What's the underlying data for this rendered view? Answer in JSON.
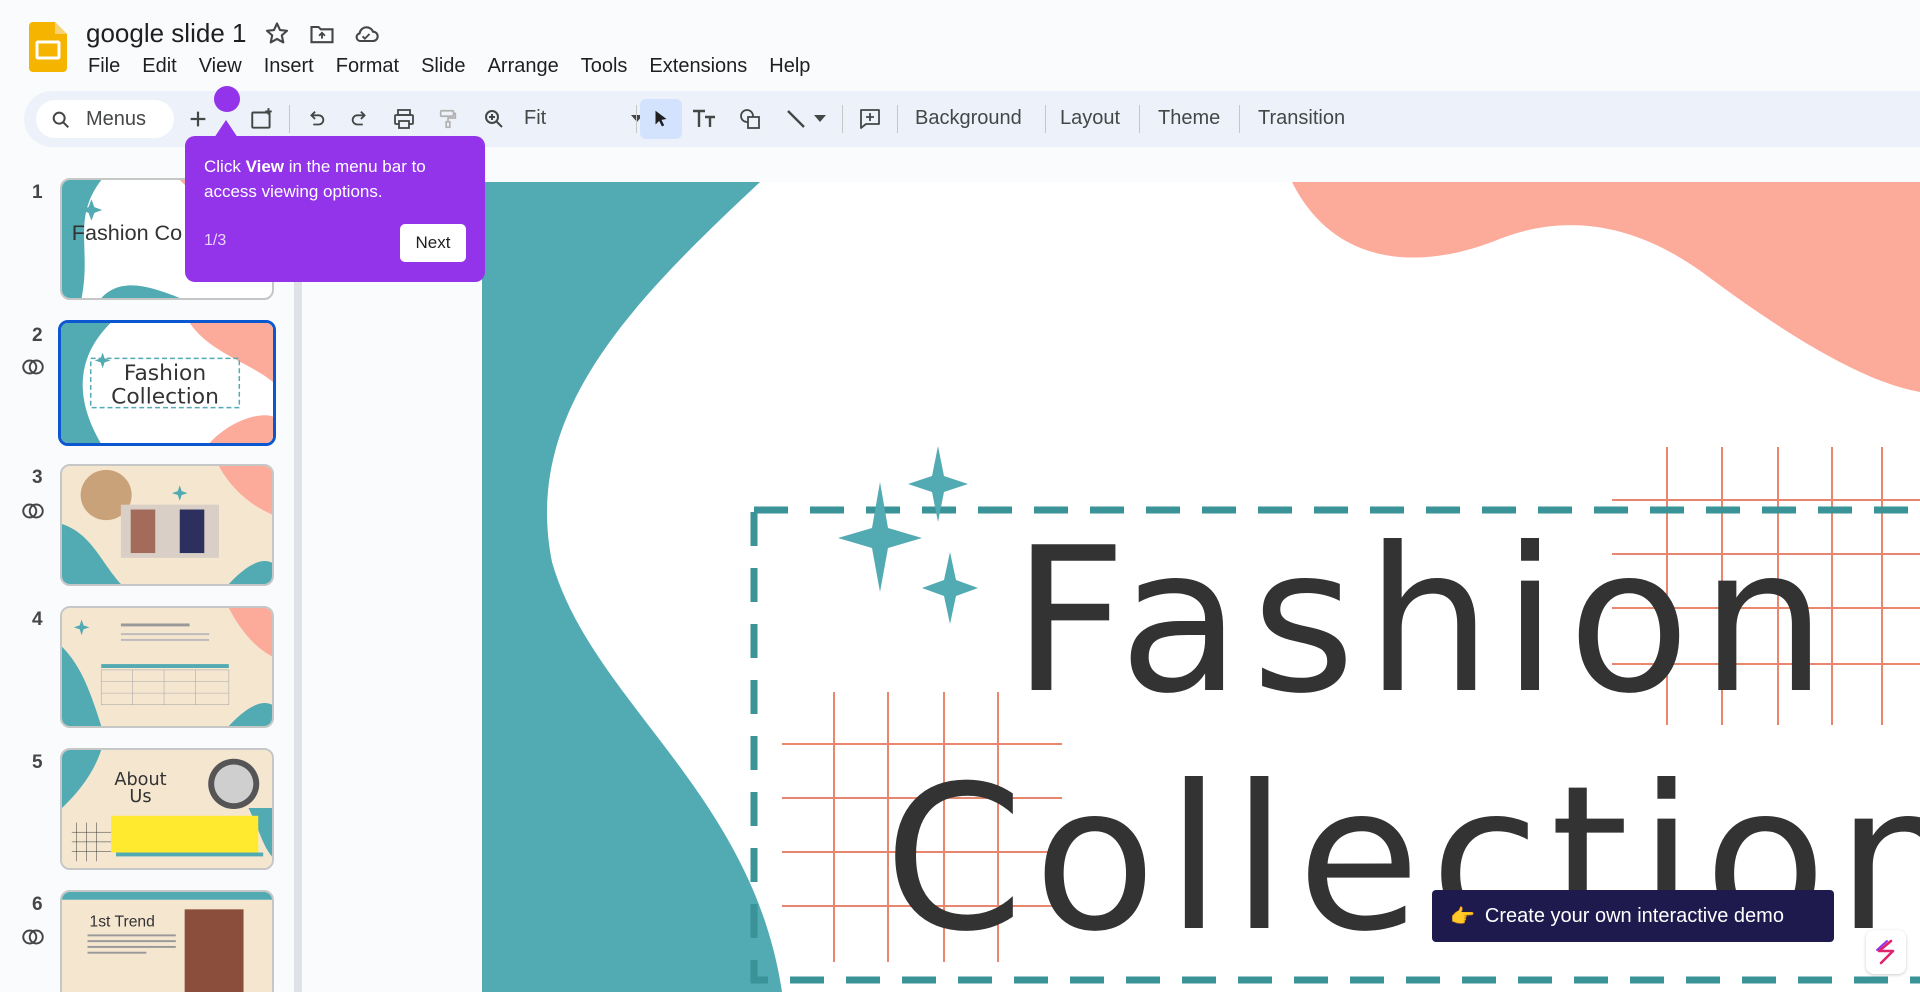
{
  "app": {
    "title": "google slide 1"
  },
  "menu": [
    "File",
    "Edit",
    "View",
    "Insert",
    "Format",
    "Slide",
    "Arrange",
    "Tools",
    "Extensions",
    "Help"
  ],
  "toolbar": {
    "search_label": "Menus",
    "zoom_value": "Fit",
    "background_label": "Background",
    "layout_label": "Layout",
    "theme_label": "Theme",
    "transition_label": "Transition"
  },
  "slides": [
    {
      "number": "1",
      "text": "Fashion Co",
      "linked": false
    },
    {
      "number": "2",
      "text_line1": "Fashion",
      "text_line2": "Collection",
      "linked": true,
      "selected": true
    },
    {
      "number": "3",
      "linked": true
    },
    {
      "number": "4",
      "linked": false
    },
    {
      "number": "5",
      "text_line1": "About",
      "text_line2": "Us",
      "linked": false
    },
    {
      "number": "6",
      "text": "1st Trend",
      "linked": true
    }
  ],
  "canvas": {
    "title_line1": "Fashion",
    "title_line2": "Collection"
  },
  "tooltip": {
    "text_before": "Click ",
    "text_bold": "View",
    "text_after": " in the menu bar to access viewing options.",
    "step": "1/3",
    "next_label": "Next"
  },
  "banner": {
    "label": "Create your own interactive demo",
    "icon": "pointing-hand-icon"
  },
  "colors": {
    "teal": "#52aab3",
    "salmon": "#fcab9b",
    "tooltip": "#9333ea",
    "banner": "#1e1a4d",
    "selected": "#0b57d0"
  }
}
